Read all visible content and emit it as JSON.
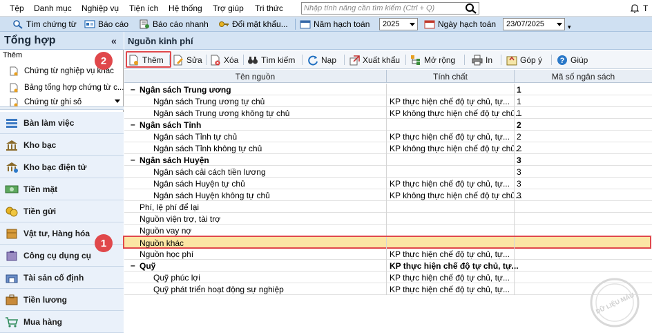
{
  "menubar": {
    "items": [
      "Tệp",
      "Danh mục",
      "Nghiệp vụ",
      "Tiện ích",
      "Hệ thống",
      "Trợ giúp",
      "Tri thức"
    ],
    "search_placeholder": "Nhập tính năng cần tìm kiếm (Ctrl + Q)",
    "search_value": "",
    "user_initial": "T"
  },
  "toolbar": {
    "find_voucher": "Tìm chứng từ",
    "report": "Báo cáo",
    "quick_report": "Báo cáo nhanh",
    "change_password": "Đổi mật khẩu...",
    "fiscal_year_label": "Năm hạch toán",
    "fiscal_year_value": "2025",
    "posting_date_label": "Ngày hạch toán",
    "posting_date_value": "23/07/2025"
  },
  "left_panel": {
    "title": "Tổng hợp",
    "section_label": "Thêm",
    "quick_items": [
      "Chứng từ nghiệp vụ khác",
      "Bảng tổng hợp chứng từ c...",
      "Chứng từ ghi sổ"
    ],
    "nav_items": [
      {
        "label": "Bàn làm việc",
        "icon": "desk-icon"
      },
      {
        "label": "Kho bạc",
        "icon": "treasury-icon"
      },
      {
        "label": "Kho bạc điện tử",
        "icon": "e-treasury-icon"
      },
      {
        "label": "Tiền mặt",
        "icon": "cash-icon"
      },
      {
        "label": "Tiền gửi",
        "icon": "deposit-icon"
      },
      {
        "label": "Vật tư, Hàng hóa",
        "icon": "goods-icon"
      },
      {
        "label": "Công cụ dụng cụ",
        "icon": "tools-icon"
      },
      {
        "label": "Tài sản cố định",
        "icon": "fixed-asset-icon"
      },
      {
        "label": "Tiền lương",
        "icon": "salary-icon"
      },
      {
        "label": "Mua hàng",
        "icon": "cart-icon"
      }
    ]
  },
  "main": {
    "title": "Nguồn kinh phí",
    "actions": {
      "add": "Thêm",
      "edit": "Sửa",
      "delete": "Xóa",
      "search": "Tìm kiếm",
      "reload": "Nạp",
      "export": "Xuất khẩu",
      "expand": "Mở rộng",
      "print": "In",
      "feedback": "Góp ý",
      "help": "Giúp"
    },
    "columns": [
      "Tên nguồn",
      "Tính chất",
      "Mã số ngân sách"
    ],
    "rows": [
      {
        "name": "Ngân sách Trung ương",
        "nature": "",
        "code": "1",
        "level": 0,
        "group": true,
        "bold": true
      },
      {
        "name": "Ngân sách Trung ương tự chủ",
        "nature": "KP thực hiện chế độ tự chủ, tự...",
        "code": "1",
        "level": 2
      },
      {
        "name": "Ngân sách Trung ương không tự chủ",
        "nature": "KP không thực hiện chế độ tự chủ...",
        "code": "1",
        "level": 2
      },
      {
        "name": "Ngân sách Tỉnh",
        "nature": "",
        "code": "2",
        "level": 0,
        "group": true,
        "bold": true
      },
      {
        "name": "Ngân sách Tỉnh tự chủ",
        "nature": "KP thực hiện chế độ tự chủ, tự...",
        "code": "2",
        "level": 2
      },
      {
        "name": "Ngân sách Tỉnh không tự chủ",
        "nature": "KP không thực hiện chế độ tự chủ...",
        "code": "2",
        "level": 2
      },
      {
        "name": "Ngân sách Huyện",
        "nature": "",
        "code": "3",
        "level": 0,
        "group": true,
        "bold": true
      },
      {
        "name": "Ngân sách cải cách tiền lương",
        "nature": "",
        "code": "3",
        "level": 2
      },
      {
        "name": "Ngân sách Huyện tự chủ",
        "nature": "KP thực hiện chế độ tự chủ, tự...",
        "code": "3",
        "level": 2
      },
      {
        "name": "Ngân sách Huyện không tự chủ",
        "nature": "KP không thực hiện chế độ tự chủ...",
        "code": "3",
        "level": 2
      },
      {
        "name": "Phí, lệ phí để lại",
        "nature": "",
        "code": "",
        "level": 1
      },
      {
        "name": "Nguồn viện trợ, tài trợ",
        "nature": "",
        "code": "",
        "level": 1
      },
      {
        "name": "Nguồn vay nợ",
        "nature": "",
        "code": "",
        "level": 1
      },
      {
        "name": "Nguồn khác",
        "nature": "",
        "code": "",
        "level": 1,
        "selected": true
      },
      {
        "name": "Nguồn học phí",
        "nature": "KP thực hiện chế độ tự chủ, tự...",
        "code": "",
        "level": 1
      },
      {
        "name": "Quỹ",
        "nature": "KP thực hiện chế độ tự chủ, tự...",
        "code": "",
        "level": 0,
        "group": true,
        "bold": true
      },
      {
        "name": "Quỹ phúc lợi",
        "nature": "KP thực hiện chế độ tự chủ, tự...",
        "code": "",
        "level": 2
      },
      {
        "name": "Quỹ phát triển hoạt động sự nghiệp",
        "nature": "KP thực hiện chế độ tự chủ, tự...",
        "code": "",
        "level": 2
      }
    ]
  },
  "callouts": {
    "step1": "1",
    "step2": "2"
  },
  "watermark_text": "DỮ LIỆU MẪU",
  "colors": {
    "accent_red": "#e0484b",
    "selected_row": "#fbe6a4",
    "toolbar_blue": "#cfe0f2"
  }
}
